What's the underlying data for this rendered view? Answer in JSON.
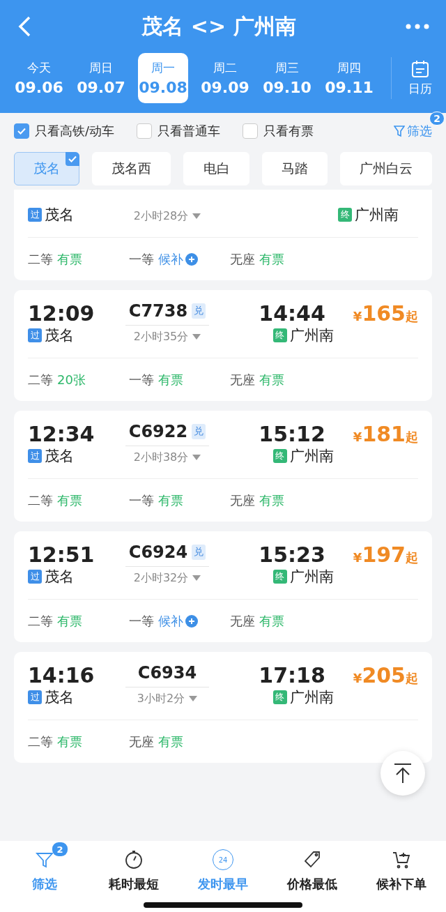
{
  "header": {
    "title": "茂名 <> 广州南",
    "calendar_label": "日历"
  },
  "dates": [
    {
      "weekday": "今天",
      "date": "09.06",
      "selected": false
    },
    {
      "weekday": "周日",
      "date": "09.07",
      "selected": false
    },
    {
      "weekday": "周一",
      "date": "09.08",
      "selected": true
    },
    {
      "weekday": "周二",
      "date": "09.09",
      "selected": false
    },
    {
      "weekday": "周三",
      "date": "09.10",
      "selected": false
    },
    {
      "weekday": "周四",
      "date": "09.11",
      "selected": false
    }
  ],
  "filters": [
    {
      "label": "只看高铁/动车",
      "checked": true
    },
    {
      "label": "只看普通车",
      "checked": false
    },
    {
      "label": "只看有票",
      "checked": false
    }
  ],
  "filter_button": {
    "label": "筛选",
    "badge": "2"
  },
  "stations": [
    {
      "label": "茂名",
      "selected": true
    },
    {
      "label": "茂名西",
      "selected": false
    },
    {
      "label": "电白",
      "selected": false
    },
    {
      "label": "马踏",
      "selected": false
    },
    {
      "label": "广州白云",
      "selected": false
    }
  ],
  "trains": [
    {
      "duration": "2小时28分",
      "from_tag": "过",
      "from": "茂名",
      "to_tag": "终",
      "to": "广州南",
      "seats": [
        {
          "class": "二等",
          "status": "有票",
          "kind": "ticket"
        },
        {
          "class": "一等",
          "status": "候补",
          "kind": "waitlist"
        },
        {
          "class": "无座",
          "status": "有票",
          "kind": "ticket"
        }
      ]
    },
    {
      "depart": "12:09",
      "train_no": "C7738",
      "exchange": "兑",
      "arrive": "14:44",
      "currency": "¥",
      "price": "165",
      "price_suffix": "起",
      "duration": "2小时35分",
      "from_tag": "过",
      "from": "茂名",
      "to_tag": "终",
      "to": "广州南",
      "seats": [
        {
          "class": "二等",
          "status": "20张",
          "kind": "ticket"
        },
        {
          "class": "一等",
          "status": "有票",
          "kind": "ticket"
        },
        {
          "class": "无座",
          "status": "有票",
          "kind": "ticket"
        }
      ]
    },
    {
      "depart": "12:34",
      "train_no": "C6922",
      "exchange": "兑",
      "arrive": "15:12",
      "currency": "¥",
      "price": "181",
      "price_suffix": "起",
      "duration": "2小时38分",
      "from_tag": "过",
      "from": "茂名",
      "to_tag": "终",
      "to": "广州南",
      "seats": [
        {
          "class": "二等",
          "status": "有票",
          "kind": "ticket"
        },
        {
          "class": "一等",
          "status": "有票",
          "kind": "ticket"
        },
        {
          "class": "无座",
          "status": "有票",
          "kind": "ticket"
        }
      ]
    },
    {
      "depart": "12:51",
      "train_no": "C6924",
      "exchange": "兑",
      "arrive": "15:23",
      "currency": "¥",
      "price": "197",
      "price_suffix": "起",
      "duration": "2小时32分",
      "from_tag": "过",
      "from": "茂名",
      "to_tag": "终",
      "to": "广州南",
      "seats": [
        {
          "class": "二等",
          "status": "有票",
          "kind": "ticket"
        },
        {
          "class": "一等",
          "status": "候补",
          "kind": "waitlist"
        },
        {
          "class": "无座",
          "status": "有票",
          "kind": "ticket"
        }
      ]
    },
    {
      "depart": "14:16",
      "train_no": "C6934",
      "arrive": "17:18",
      "currency": "¥",
      "price": "205",
      "price_suffix": "起",
      "duration": "3小时2分",
      "from_tag": "过",
      "from": "茂名",
      "to_tag": "终",
      "to": "广州南",
      "seats": [
        {
          "class": "二等",
          "status": "有票",
          "kind": "ticket"
        },
        {
          "class": "无座",
          "status": "有票",
          "kind": "ticket"
        }
      ]
    }
  ],
  "bottom_bar": [
    {
      "label": "筛选",
      "kind": "funnel",
      "badge": "2",
      "selected": true
    },
    {
      "label": "耗时最短",
      "kind": "stopwatch",
      "selected": false
    },
    {
      "label": "发时最早",
      "kind": "clock24",
      "icon_text": "24",
      "selected": true
    },
    {
      "label": "价格最低",
      "kind": "tag",
      "selected": false
    },
    {
      "label": "候补下单",
      "kind": "cart",
      "selected": false
    }
  ]
}
